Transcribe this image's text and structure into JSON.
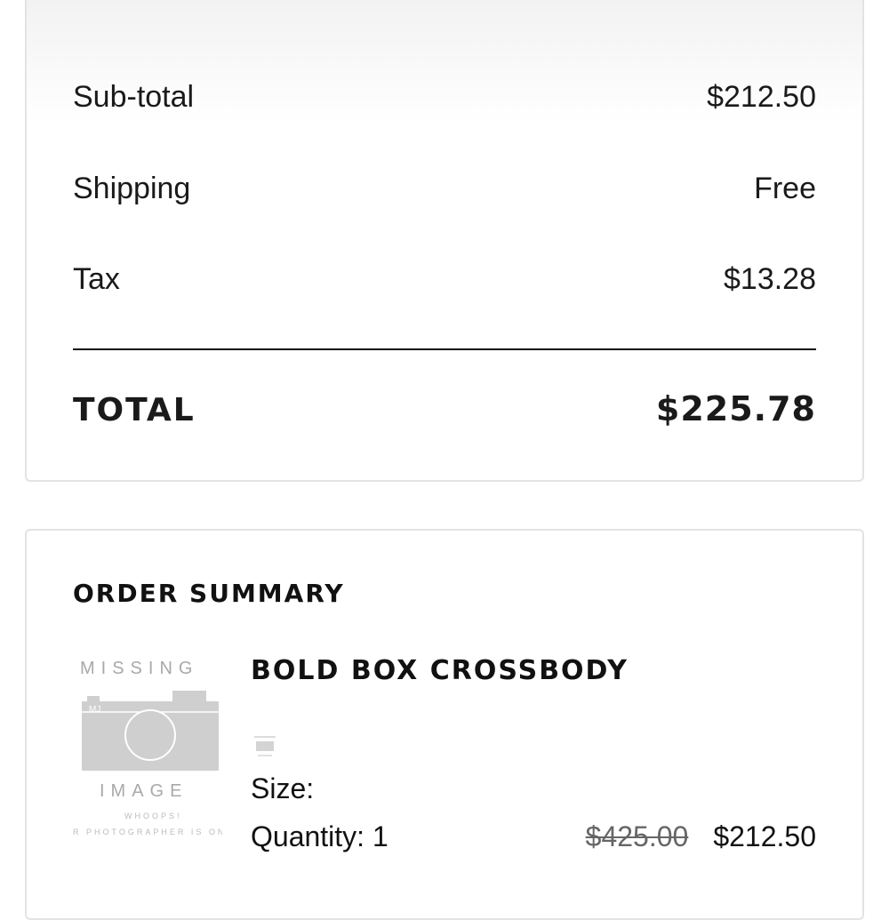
{
  "totals": {
    "subtotal_label": "Sub-total",
    "subtotal_value": "$212.50",
    "shipping_label": "Shipping",
    "shipping_value": "Free",
    "tax_label": "Tax",
    "tax_value": "$13.28",
    "total_label": "TOTAL",
    "total_value": "$225.78"
  },
  "order_summary": {
    "heading": "ORDER SUMMARY",
    "items": [
      {
        "image": {
          "top_text": "MISSING",
          "bottom_text": "IMAGE",
          "brand": "MJ",
          "whoops": "WHOOPS!",
          "note": "R PHOTOGRAPHER IS ON"
        },
        "name": "BOLD BOX CROSSBODY",
        "size_label": "Size:",
        "quantity_label": "Quantity: 1",
        "original_price": "$425.00",
        "price": "$212.50"
      }
    ]
  }
}
